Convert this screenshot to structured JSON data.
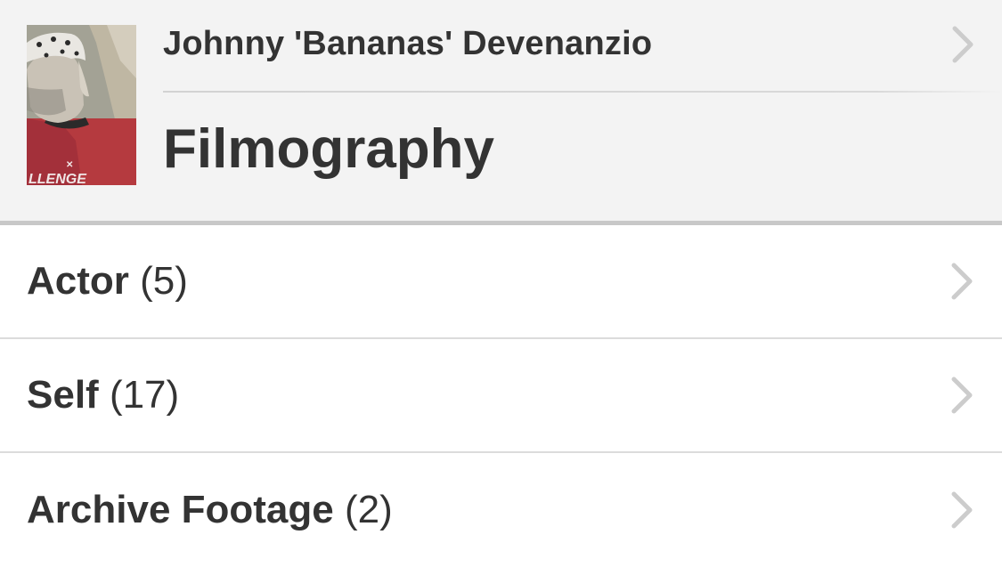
{
  "header": {
    "person_name": "Johnny 'Bananas' Devenanzio",
    "page_title": "Filmography",
    "avatar": {
      "icon": "person-photo",
      "shirt_text": "LLENGE"
    }
  },
  "categories": [
    {
      "title": "Actor",
      "count": "(5)"
    },
    {
      "title": "Self",
      "count": "(17)"
    },
    {
      "title": "Archive Footage",
      "count": "(2)"
    }
  ],
  "colors": {
    "text": "#333333",
    "header_bg": "#f3f3f3",
    "chevron": "#cccccc",
    "divider": "#dcdcdc"
  }
}
